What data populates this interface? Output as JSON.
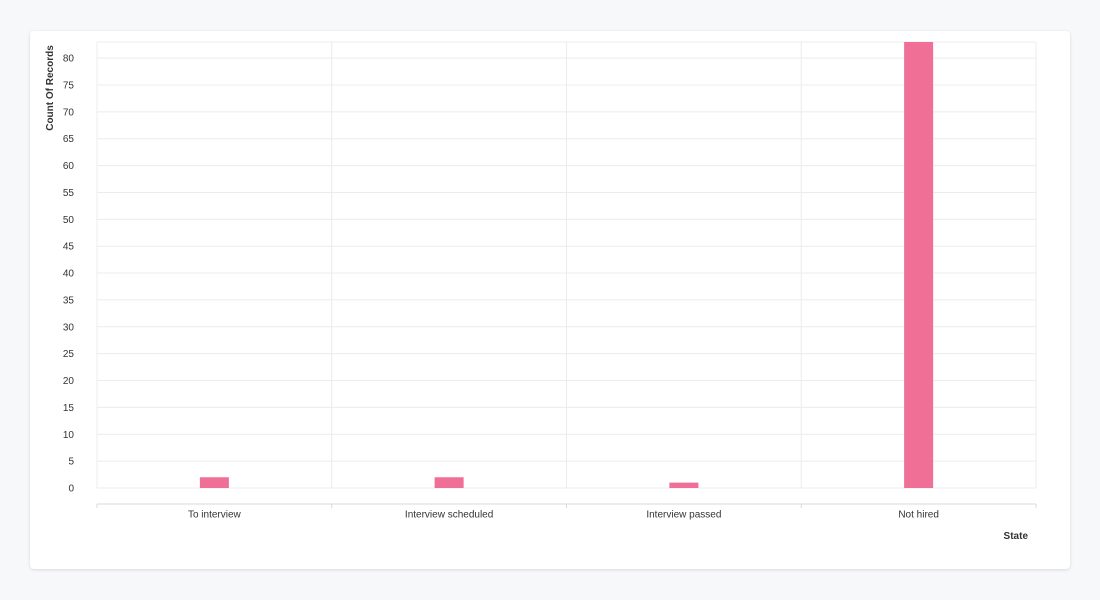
{
  "chart_data": {
    "type": "bar",
    "categories": [
      "To interview",
      "Interview scheduled",
      "Interview passed",
      "Not hired"
    ],
    "values": [
      2,
      2,
      1,
      83
    ],
    "ylabel": "Count Of Records",
    "xlabel": "State",
    "ylim": [
      0,
      83
    ],
    "yticks": [
      0,
      5,
      10,
      15,
      20,
      25,
      30,
      35,
      40,
      45,
      50,
      55,
      60,
      65,
      70,
      75,
      80
    ],
    "grid": true,
    "bar_color": "#f06f96"
  }
}
